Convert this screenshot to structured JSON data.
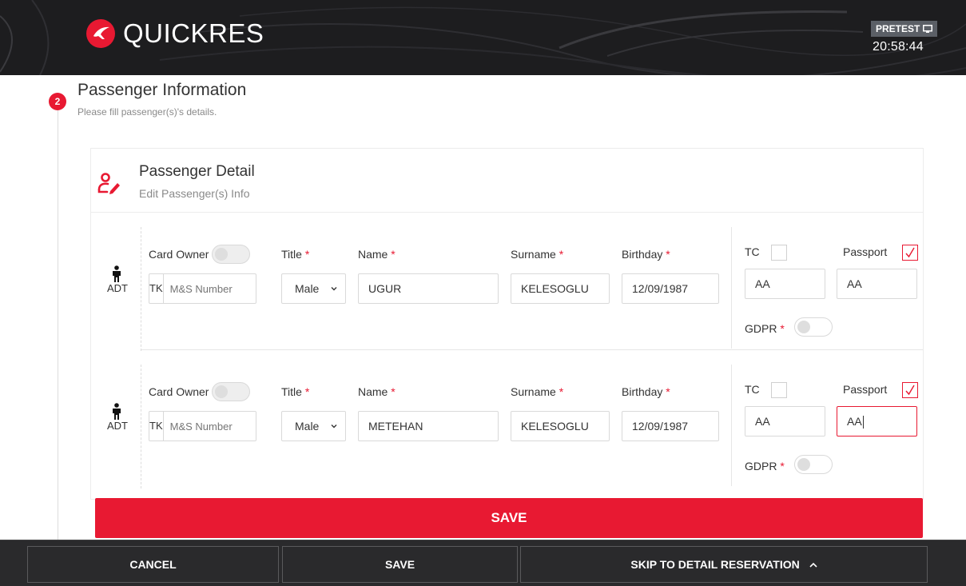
{
  "header": {
    "brand": "QUICKRES",
    "env_label": "PRETEST",
    "time": "20:58:44",
    "brand_color": "#e81932"
  },
  "step": {
    "number": "2",
    "title": "Passenger Information",
    "subtitle": "Please fill passenger(s)'s details."
  },
  "card": {
    "title": "Passenger Detail",
    "subtitle": "Edit Passenger(s) Info"
  },
  "labels": {
    "card_owner": "Card Owner",
    "title": "Title",
    "name": "Name",
    "surname": "Surname",
    "birthday": "Birthday",
    "tc": "TC",
    "passport": "Passport",
    "gdpr": "GDPR",
    "required_mark": "*",
    "ms_prefix": "TK",
    "ms_placeholder": "M&S Number"
  },
  "passengers": [
    {
      "type": "ADT",
      "title": "Male",
      "name": "UGUR",
      "surname": "KELESOGLU",
      "birthday": "12/09/1987",
      "tc_checked": false,
      "passport_checked": true,
      "tc_value": "AA",
      "passport_value": "AA",
      "gdpr_on": false,
      "card_owner_on": false
    },
    {
      "type": "ADT",
      "title": "Male",
      "name": "METEHAN",
      "surname": "KELESOGLU",
      "birthday": "12/09/1987",
      "tc_checked": false,
      "passport_checked": true,
      "tc_value": "AA",
      "passport_value": "AA",
      "gdpr_on": false,
      "card_owner_on": false
    }
  ],
  "save_bar_label": "SAVE",
  "footer": {
    "cancel": "CANCEL",
    "save": "SAVE",
    "skip": "SKIP TO DETAIL RESERVATION"
  }
}
